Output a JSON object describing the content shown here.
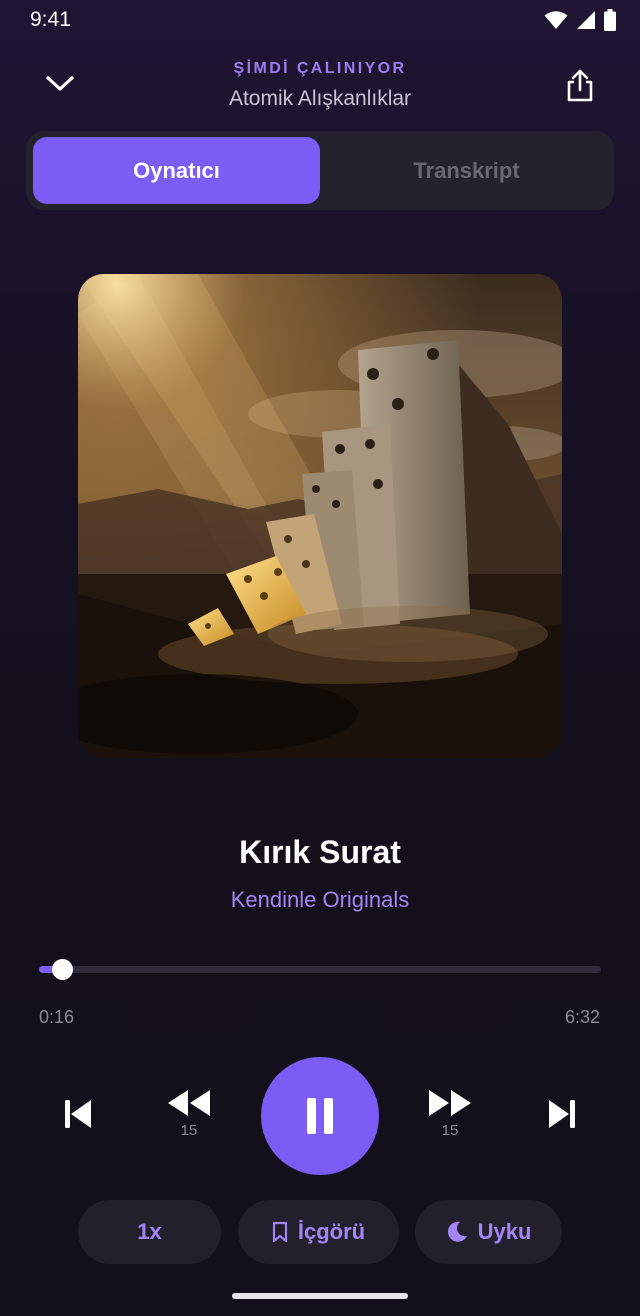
{
  "status_bar": {
    "time": "9:41",
    "icons": [
      "wifi-icon",
      "signal-icon",
      "battery-icon"
    ]
  },
  "header": {
    "now_playing_label": "ŞİMDİ ÇALINIYOR",
    "book_title": "Atomik Alışkanlıklar",
    "back_icon": "chevron-down-icon",
    "share_icon": "share-icon"
  },
  "tabs": [
    {
      "label": "Oynatıcı",
      "active": true
    },
    {
      "label": "Transkript",
      "active": false
    }
  ],
  "artwork": {
    "icon": "domino-artwork-image"
  },
  "episode": {
    "title": "Kırık Surat",
    "author": "Kendinle Originals"
  },
  "progress": {
    "elapsed": "0:16",
    "total": "6:32",
    "fraction": 0.041
  },
  "controls": {
    "skip_back_label": "15",
    "skip_forward_label": "15",
    "state": "playing"
  },
  "pills": {
    "speed": "1x",
    "insight": "İçgörü",
    "sleep": "Uyku"
  },
  "colors": {
    "accent": "#7b5cf5",
    "accent_text": "#a285f5",
    "background": "#13101c"
  }
}
